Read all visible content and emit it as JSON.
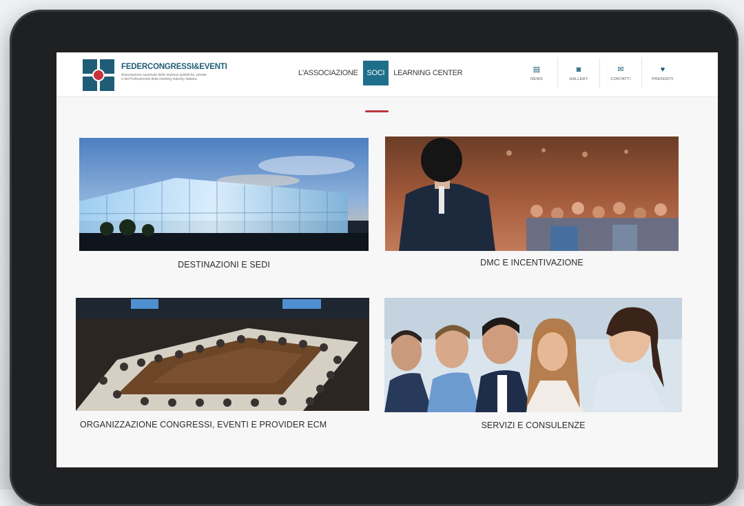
{
  "logo": {
    "name": "FEDERCONGRESSI&EVENTI",
    "tagline_1": "Associazione nazionale delle imprese pubbliche, private",
    "tagline_2": "e dei Professionisti della meeting industry italiana"
  },
  "nav": {
    "items": [
      {
        "label": "L'ASSOCIAZIONE",
        "active": false
      },
      {
        "label": "SOCI",
        "active": true
      },
      {
        "label": "LEARNING CENTER",
        "active": false
      }
    ],
    "icons": [
      {
        "label": "NEWS",
        "icon": "newspaper-icon",
        "glyph": "▤"
      },
      {
        "label": "GALLERY",
        "icon": "camera-icon",
        "glyph": "◙"
      },
      {
        "label": "CONTATTI",
        "icon": "envelope-icon",
        "glyph": "✉"
      },
      {
        "label": "PREFERITI",
        "icon": "heart-icon",
        "glyph": "♥"
      }
    ]
  },
  "colors": {
    "brand": "#1f5d77",
    "accent": "#c8323c",
    "nav_active": "#1f6f8b"
  },
  "cards": [
    {
      "caption": "DESTINAZIONI E SEDI",
      "image": "convention-center-at-dusk"
    },
    {
      "caption": "DMC E INCENTIVAZIONE",
      "image": "speaker-facing-audience"
    },
    {
      "caption": "ORGANIZZAZIONE CONGRESSI, EVENTI E PROVIDER ECM",
      "image": "conference-round-table"
    },
    {
      "caption": "SERVIZI E CONSULENZE",
      "image": "smiling-business-team"
    }
  ]
}
